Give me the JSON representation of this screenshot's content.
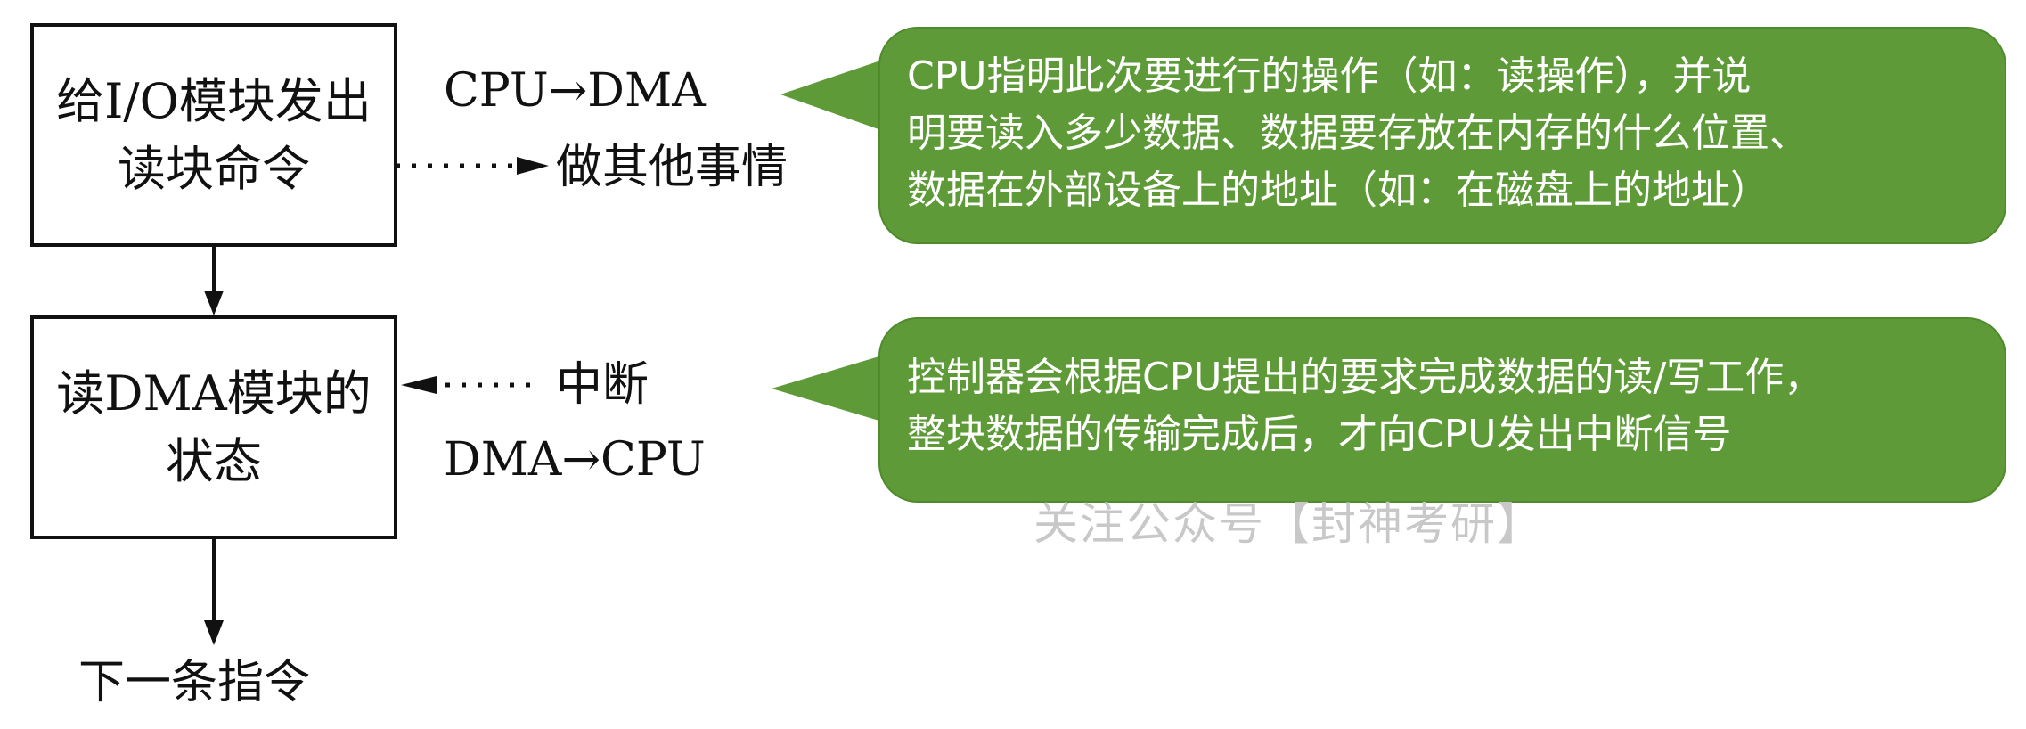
{
  "boxes": {
    "issue_read": "给I/O模块发出\n读块命令",
    "read_status": "读DMA模块的\n状态"
  },
  "labels": {
    "cpu_to_dma": "CPU→DMA",
    "do_other": "做其他事情",
    "interrupt": "中断",
    "dma_to_cpu": "DMA→CPU",
    "next_instruction": "下一条指令"
  },
  "callouts": {
    "top": [
      "CPU指明此次要进行的操作（如：读操作），并说",
      "明要读入多少数据、数据要存放在内存的什么位置、",
      "数据在外部设备上的地址（如：在磁盘上的地址）"
    ],
    "bottom": [
      "控制器会根据CPU提出的要求完成数据的读/写工作，",
      "整块数据的传输完成后，才向CPU发出中断信号"
    ]
  },
  "watermark": "关注公众号【封神考研】",
  "colors": {
    "callout_fill": "#5e9a37",
    "callout_text": "#ffffff",
    "line": "#111111",
    "watermark": "#c8c8c8"
  }
}
